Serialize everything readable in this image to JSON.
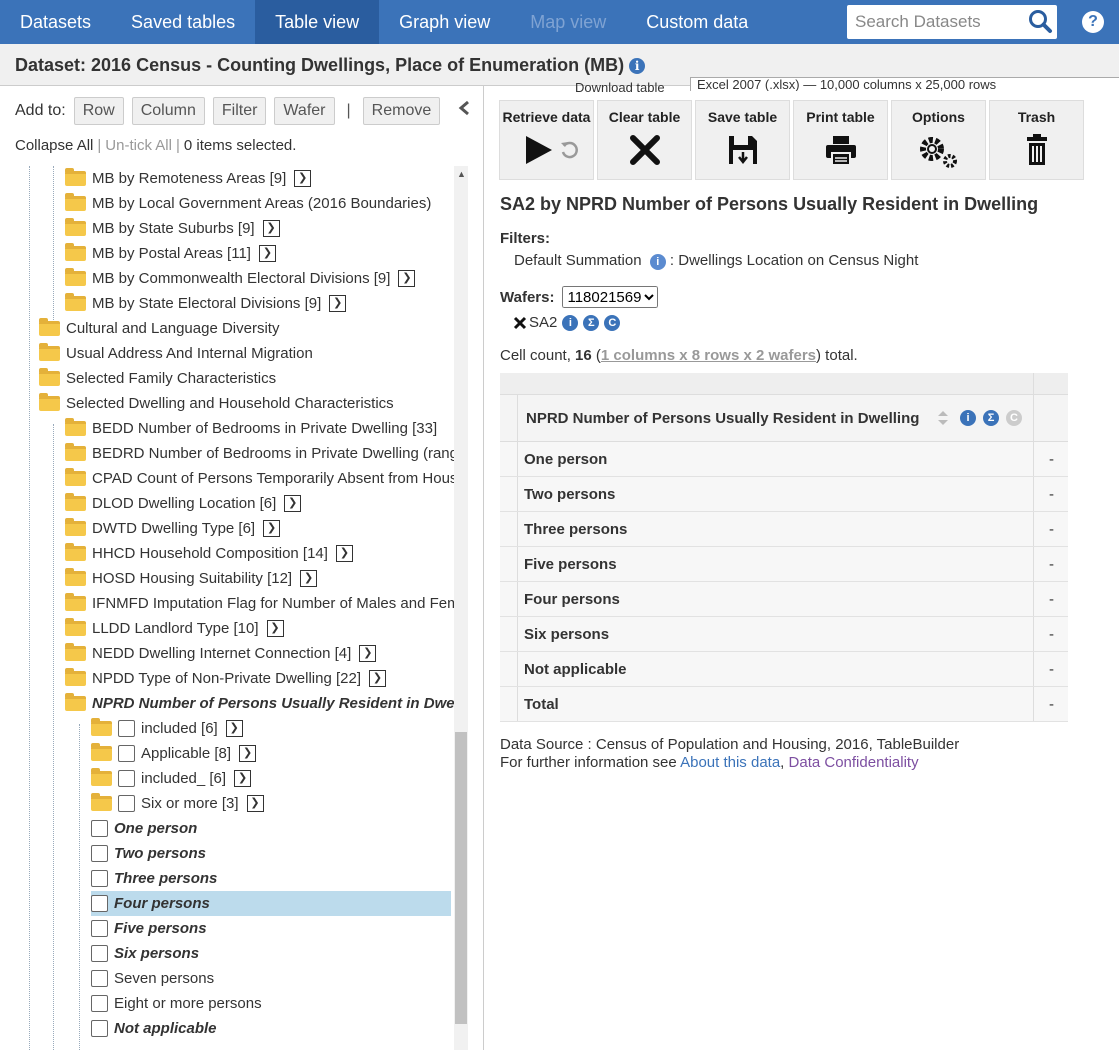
{
  "nav": {
    "tabs": [
      "Datasets",
      "Saved tables",
      "Table view",
      "Graph view",
      "Map view",
      "Custom data"
    ],
    "search_placeholder": "Search Datasets",
    "help": "?"
  },
  "dataset": {
    "title": "Dataset: 2016 Census - Counting Dwellings, Place of Enumeration (MB)",
    "info": "i",
    "bottom_label": "Download table",
    "bottom_select": "Excel 2007 (.xlsx) — 10,000 columns x 25,000 rows"
  },
  "left": {
    "add_to": "Add to:",
    "buttons": [
      "Row",
      "Column",
      "Filter",
      "Wafer"
    ],
    "separator": "|",
    "remove": "Remove",
    "collapse_all": "Collapse All",
    "untick_all": "Un-tick All",
    "selected": "0 items selected.",
    "tree": [
      {
        "label": "MB by Remoteness Areas [9]",
        "level": 2,
        "type": "folder",
        "arrow": true
      },
      {
        "label": "MB by Local Government Areas (2016 Boundaries)",
        "level": 2,
        "type": "folder",
        "arrow": false
      },
      {
        "label": "MB by State Suburbs [9]",
        "level": 2,
        "type": "folder",
        "arrow": true
      },
      {
        "label": "MB by Postal Areas [11]",
        "level": 2,
        "type": "folder",
        "arrow": true
      },
      {
        "label": "MB by Commonwealth Electoral Divisions [9]",
        "level": 2,
        "type": "folder",
        "arrow": true
      },
      {
        "label": "MB by State Electoral Divisions [9]",
        "level": 2,
        "type": "folder",
        "arrow": true
      },
      {
        "label": "Cultural and Language Diversity",
        "level": 1,
        "type": "folder",
        "arrow": false
      },
      {
        "label": "Usual Address And Internal Migration",
        "level": 1,
        "type": "folder",
        "arrow": false
      },
      {
        "label": "Selected Family Characteristics",
        "level": 1,
        "type": "folder",
        "arrow": false
      },
      {
        "label": "Selected Dwelling and Household Characteristics",
        "level": 1,
        "type": "folder",
        "arrow": false
      },
      {
        "label": "BEDD Number of Bedrooms in Private Dwelling [33]",
        "level": 2,
        "type": "folder",
        "arrow": false
      },
      {
        "label": "BEDRD Number of Bedrooms in Private Dwelling (ranges)",
        "level": 2,
        "type": "folder",
        "arrow": false
      },
      {
        "label": "CPAD Count of Persons Temporarily Absent from Household",
        "level": 2,
        "type": "folder",
        "arrow": false
      },
      {
        "label": "DLOD Dwelling Location [6]",
        "level": 2,
        "type": "folder",
        "arrow": true
      },
      {
        "label": "DWTD Dwelling Type [6]",
        "level": 2,
        "type": "folder",
        "arrow": true
      },
      {
        "label": "HHCD Household Composition [14]",
        "level": 2,
        "type": "folder",
        "arrow": true
      },
      {
        "label": "HOSD Housing Suitability [12]",
        "level": 2,
        "type": "folder",
        "arrow": true
      },
      {
        "label": "IFNMFD Imputation Flag for Number of Males and Females",
        "level": 2,
        "type": "folder",
        "arrow": false
      },
      {
        "label": "LLDD Landlord Type [10]",
        "level": 2,
        "type": "folder",
        "arrow": true
      },
      {
        "label": "NEDD Dwelling Internet Connection [4]",
        "level": 2,
        "type": "folder",
        "arrow": true
      },
      {
        "label": "NPDD Type of Non-Private Dwelling [22]",
        "level": 2,
        "type": "folder",
        "arrow": true
      },
      {
        "label": "NPRD Number of Persons Usually Resident in Dwelling",
        "level": 2,
        "type": "folder",
        "arrow": false,
        "bold": true
      },
      {
        "label": "included [6]",
        "level": 3,
        "type": "folder-cb",
        "arrow": true
      },
      {
        "label": "Applicable [8]",
        "level": 3,
        "type": "folder-cb",
        "arrow": true
      },
      {
        "label": "included_ [6]",
        "level": 3,
        "type": "folder-cb",
        "arrow": true
      },
      {
        "label": "Six or more [3]",
        "level": 3,
        "type": "folder-cb",
        "arrow": true
      },
      {
        "label": "One person",
        "level": 3,
        "type": "cb",
        "bold": true
      },
      {
        "label": "Two persons",
        "level": 3,
        "type": "cb",
        "bold": true
      },
      {
        "label": "Three persons",
        "level": 3,
        "type": "cb",
        "bold": true
      },
      {
        "label": "Four persons",
        "level": 3,
        "type": "cb",
        "bold": true,
        "highlight": true
      },
      {
        "label": "Five persons",
        "level": 3,
        "type": "cb",
        "bold": true
      },
      {
        "label": "Six persons",
        "level": 3,
        "type": "cb",
        "bold": true
      },
      {
        "label": "Seven persons",
        "level": 3,
        "type": "cb"
      },
      {
        "label": "Eight or more persons",
        "level": 3,
        "type": "cb"
      },
      {
        "label": "Not applicable",
        "level": 3,
        "type": "cb",
        "bold": true
      }
    ]
  },
  "toolbar": [
    "Retrieve data",
    "Clear table",
    "Save table",
    "Print table",
    "Options",
    "Trash"
  ],
  "table_title": "SA2 by NPRD Number of Persons Usually Resident in Dwelling",
  "filters": {
    "label": "Filters:",
    "item": "Default Summation",
    "value": ": Dwellings Location on Census Night"
  },
  "wafers": {
    "label": "Wafers:",
    "selected": "118021569",
    "tag": "SA2"
  },
  "cell_count": {
    "prefix": "Cell count, ",
    "count": "16",
    "link": "1 columns x 8 rows x 2 wafers",
    "suffix": " total."
  },
  "grid": {
    "header": "NPRD Number of Persons Usually Resident in Dwelling",
    "rows": [
      {
        "label": "One person",
        "value": "-"
      },
      {
        "label": "Two persons",
        "value": "-"
      },
      {
        "label": "Three persons",
        "value": "-"
      },
      {
        "label": "Five persons",
        "value": "-"
      },
      {
        "label": "Four persons",
        "value": "-"
      },
      {
        "label": "Six persons",
        "value": "-"
      },
      {
        "label": "Not applicable",
        "value": "-"
      },
      {
        "label": "Total",
        "value": "-"
      }
    ]
  },
  "source": {
    "line1": "Data Source : Census of Population and Housing, 2016, TableBuilder",
    "line2": "For further information see ",
    "link1": "About this data",
    "comma": ", ",
    "link2": "Data Confidentiality"
  }
}
